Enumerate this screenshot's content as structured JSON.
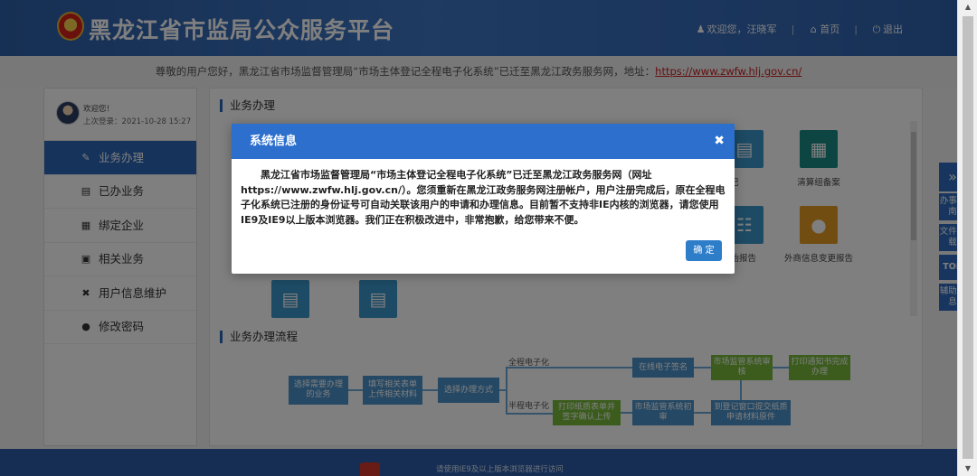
{
  "header": {
    "title": "黑龙江省市监局公众服务平台",
    "user_text": "欢迎您，汪晓军",
    "home_label": "首页",
    "logout_label": "退出"
  },
  "notice": {
    "text": "尊敬的用户您好，黑龙江省市场监督管理局“市场主体登记全程电子化系统”已迁至黑龙江政务服务网，地址：",
    "url": "https://www.zwfw.hlj.gov.cn/"
  },
  "sidebar": {
    "welcome": "欢迎您！",
    "last_login": "上次登录：2021-10-28 15:27",
    "items": [
      {
        "label": "业务办理",
        "icon": "edit-icon"
      },
      {
        "label": "已办业务",
        "icon": "done-doc-icon"
      },
      {
        "label": "绑定企业",
        "icon": "building-icon"
      },
      {
        "label": "相关业务",
        "icon": "search-doc-icon"
      },
      {
        "label": "用户信息维护",
        "icon": "tools-icon"
      },
      {
        "label": "修改密码",
        "icon": "lock-icon"
      }
    ]
  },
  "content": {
    "section1_title": "业务办理",
    "tiles": {
      "t1_label": "登记",
      "t2_label": "清算组备案",
      "t3_label": "初始报告",
      "t4_label": "外商信息变更报告"
    },
    "section2_title": "业务办理流程",
    "flow": {
      "step_select": "选择需要办理的业务",
      "step_fill": "填写相关表单上传相关材料",
      "step_mode": "选择办理方式",
      "label_full": "全程电子化",
      "label_half": "半程电子化",
      "step_sign": "在线电子签名",
      "step_review": "市场监管系统审核",
      "step_notice": "打印通知书完成办理",
      "step_print": "打印纸质表单并签字确认上传",
      "step_init_review": "市场监管系统初审",
      "step_submit": "到登记窗口提交纸质申请材料原件"
    }
  },
  "footer": {
    "text": "请使用IE9及以上版本浏览器进行访问"
  },
  "right_float": {
    "items": [
      "办事指南",
      "文件下载",
      "TOP",
      "辅助信息"
    ]
  },
  "modal": {
    "title": "系统信息",
    "body": "黑龙江省市场监督管理局“市场主体登记全程电子化系统”已迁至黑龙江政务服务网（网址https://www.zwfw.hlj.gov.cn/）。您须重新在黑龙江政务服务网注册帐户，用户注册完成后，原在全程电子化系统已注册的身份证号可自动关联该用户的申请和办理信息。目前暂不支持非IE内核的浏览器，请您使用IE9及IE9以上版本浏览器。我们正在积极改进中，非常抱歉，给您带来不便。",
    "ok_label": "确 定"
  }
}
